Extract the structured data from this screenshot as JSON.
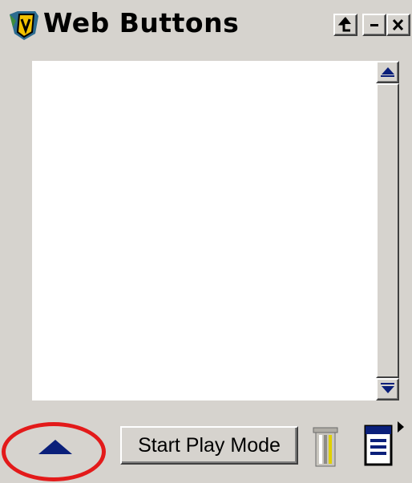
{
  "window": {
    "title": "Web Buttons",
    "pin_label": "t",
    "minimize_label": "−",
    "close_label": "x"
  },
  "list": {
    "items": []
  },
  "toolbar": {
    "start_play_label": "Start Play Mode",
    "icons": {
      "play_toggle": "up-triangle-icon",
      "trash": "trash-icon",
      "options": "document-menu-icon"
    }
  },
  "colors": {
    "panel": "#d6d3ce",
    "accent_blue": "#0a1f7a",
    "highlight_red": "#e31a1a"
  }
}
